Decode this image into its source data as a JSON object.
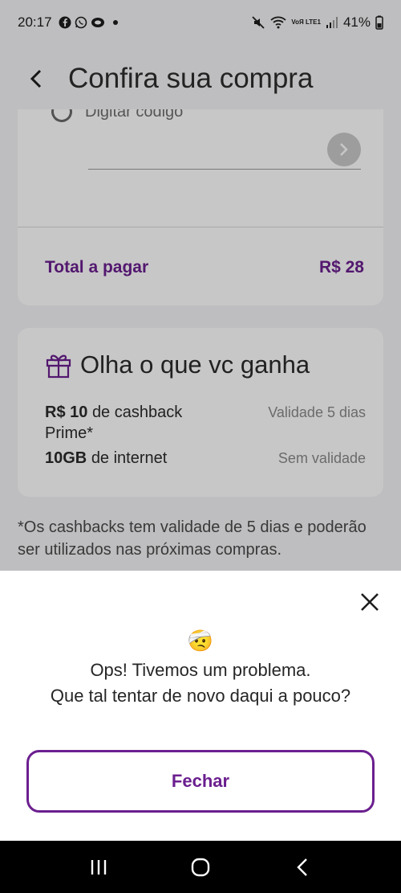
{
  "status_bar": {
    "time": "20:17",
    "icons_left": [
      "facebook-icon",
      "whatsapp-icon",
      "chat-icon"
    ],
    "volte": "VoЯ LTE1",
    "battery": "41%"
  },
  "header": {
    "title": "Confira sua compra"
  },
  "coupon": {
    "placeholder": "Digitar código"
  },
  "total": {
    "label": "Total a pagar",
    "value": "R$ 28"
  },
  "bonus": {
    "title": "Olha o que vc ganha",
    "items": [
      {
        "amount": "R$ 10",
        "desc": "de cashback Prime*",
        "validity": "Validade 5 dias"
      },
      {
        "amount": "10GB",
        "desc": "de internet",
        "validity": "Sem validade"
      }
    ]
  },
  "footnote": "*Os cashbacks tem validade de 5 dias e poderão ser utilizados nas próximas compras.",
  "dialog": {
    "emoji": "🤕",
    "line1": "Ops! Tivemos um problema.",
    "line2": "Que tal tentar de novo daqui a pouco?",
    "button": "Fechar"
  },
  "colors": {
    "accent": "#6b1f8f",
    "background": "#f4f4f6"
  }
}
